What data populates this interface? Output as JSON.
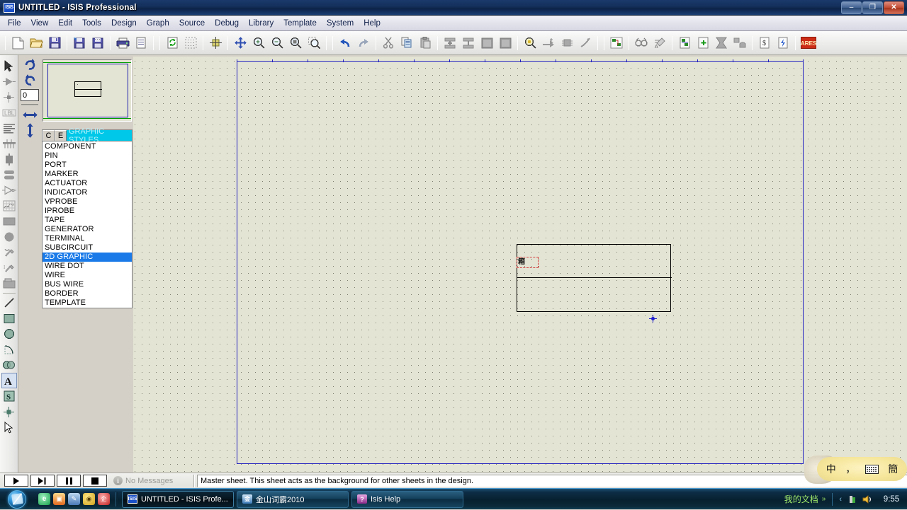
{
  "window": {
    "title": "UNTITLED - ISIS Professional",
    "app_icon": "isis-icon",
    "icon_label": "ISIS",
    "controls": {
      "minimize": "–",
      "restore": "❐",
      "close": "✕"
    }
  },
  "menubar": {
    "items": [
      {
        "label": "File",
        "name": "menu-file"
      },
      {
        "label": "View",
        "name": "menu-view"
      },
      {
        "label": "Edit",
        "name": "menu-edit"
      },
      {
        "label": "Tools",
        "name": "menu-tools"
      },
      {
        "label": "Design",
        "name": "menu-design"
      },
      {
        "label": "Graph",
        "name": "menu-graph"
      },
      {
        "label": "Source",
        "name": "menu-source"
      },
      {
        "label": "Debug",
        "name": "menu-debug"
      },
      {
        "label": "Library",
        "name": "menu-library"
      },
      {
        "label": "Template",
        "name": "menu-template"
      },
      {
        "label": "System",
        "name": "menu-system"
      },
      {
        "label": "Help",
        "name": "menu-help"
      }
    ]
  },
  "toolbar": {
    "groups": [
      [
        "new-file-icon",
        "open-folder-icon",
        "save-icon"
      ],
      [
        "save-as-icon",
        "import-section-icon"
      ],
      [
        "print-icon",
        "print-area-icon"
      ],
      [
        "refresh-icon",
        "toggle-grid-icon"
      ],
      [
        "origin-icon"
      ],
      [
        "pan-icon",
        "zoom-in-icon",
        "zoom-out-icon",
        "zoom-area-icon",
        "zoom-window-icon"
      ],
      [
        "undo-icon",
        "redo-icon"
      ],
      [
        "cut-icon",
        "copy-icon",
        "paste-icon"
      ],
      [
        "block-copy-icon",
        "block-move-icon",
        "block-rotate-icon",
        "block-delete-icon"
      ],
      [
        "pick-device-icon",
        "make-device-icon",
        "package-tool-icon",
        "decompose-icon"
      ],
      [
        "wire-label-icon"
      ],
      [
        "property-assign-icon"
      ],
      [
        "netlist-icon",
        "electrical-check-icon"
      ],
      [
        "new-sheet-icon",
        "remove-sheet-icon",
        "exit-sheet-icon",
        "sheet-hierarchy-icon"
      ],
      [
        "bom-report-icon",
        "electrical-report-icon"
      ],
      [
        "ares-button"
      ]
    ],
    "ares_label": "ARES"
  },
  "vtoolbar": {
    "items": [
      {
        "name": "selection-mode-icon",
        "label": "Selection Mode",
        "selected": false
      },
      {
        "name": "component-mode-icon",
        "label": "Component Mode",
        "selected": false
      },
      {
        "name": "junction-dot-icon",
        "label": "Junction Dot Mode",
        "selected": false
      },
      {
        "name": "wire-label-icon",
        "label": "Wire Label Mode",
        "selected": false
      },
      {
        "name": "text-script-icon",
        "label": "Text Script Mode",
        "selected": false
      },
      {
        "name": "buses-icon",
        "label": "Buses Mode",
        "selected": false
      },
      {
        "name": "subcircuit-icon",
        "label": "Subcircuit Mode",
        "selected": false
      },
      {
        "name": "terminals-icon",
        "label": "Terminals Mode",
        "selected": false
      },
      {
        "name": "device-pin-icon",
        "label": "Device Pins Mode",
        "selected": false
      },
      {
        "name": "graph-icon",
        "label": "Graph Mode",
        "selected": false
      },
      {
        "name": "tape-recorder-icon",
        "label": "Tape Recorder",
        "selected": false
      },
      {
        "name": "generator-icon",
        "label": "Generator Mode",
        "selected": false
      },
      {
        "name": "voltage-probe-icon",
        "label": "Voltage Probe",
        "selected": false
      },
      {
        "name": "current-probe-icon",
        "label": "Current Probe",
        "selected": false
      },
      {
        "name": "virtual-instrument-icon",
        "label": "Virtual Instruments",
        "selected": false
      },
      {
        "name": "line-tool-icon",
        "label": "2D Line",
        "selected": false
      },
      {
        "name": "box-tool-icon",
        "label": "2D Box",
        "selected": false
      },
      {
        "name": "circle-tool-icon",
        "label": "2D Circle",
        "selected": false
      },
      {
        "name": "arc-tool-icon",
        "label": "2D Arc",
        "selected": false
      },
      {
        "name": "path-tool-icon",
        "label": "2D Closed Path",
        "selected": false
      },
      {
        "name": "text-tool-icon",
        "label": "2D Text",
        "selected": true
      },
      {
        "name": "symbol-tool-icon",
        "label": "2D Symbol",
        "selected": false
      },
      {
        "name": "marker-tool-icon",
        "label": "2D Marker",
        "selected": false
      },
      {
        "name": "cursor-pointer-icon",
        "label": "Pointer",
        "selected": false
      }
    ]
  },
  "orientation": {
    "rotate_cw": "rotate-clockwise-icon",
    "rotate_ccw": "rotate-counterclockwise-icon",
    "angle_value": "0",
    "mirror_x": "mirror-horizontal-icon",
    "mirror_y": "mirror-vertical-icon"
  },
  "preview": {
    "name": "object-preview-panel"
  },
  "selector": {
    "tabs": [
      {
        "label": "C",
        "name": "tab-components"
      },
      {
        "label": "E",
        "name": "tab-edit"
      }
    ],
    "title": "GRAPHIC STYLES",
    "items": [
      "COMPONENT",
      "PIN",
      "PORT",
      "MARKER",
      "ACTUATOR",
      "INDICATOR",
      "VPROBE",
      "IPROBE",
      "TAPE",
      "GENERATOR",
      "TERMINAL",
      "SUBCIRCUIT",
      "2D GRAPHIC",
      "WIRE DOT",
      "WIRE",
      "BUS WIRE",
      "BORDER",
      "TEMPLATE"
    ],
    "selected_index": 12
  },
  "canvas": {
    "name": "schematic-canvas",
    "selected_object_glyph": "箱",
    "sheet_border_color": "#2020c0",
    "grid_color": "#6a6a5e",
    "background_color": "#e4e4d4"
  },
  "statusbar": {
    "animation_controls": [
      {
        "name": "play-button",
        "glyph": "▶"
      },
      {
        "name": "step-button",
        "glyph": "▶|"
      },
      {
        "name": "pause-button",
        "glyph": "❙❙"
      },
      {
        "name": "stop-button",
        "glyph": "■"
      }
    ],
    "messages_icon": "info-icon",
    "messages_label": "No Messages",
    "status_text": "Master sheet. This sheet acts as the background for other sheets in the design."
  },
  "taskbar": {
    "start_button": "start-orb",
    "quick_launch": [
      {
        "name": "ql-browser-icon",
        "glyph": "e"
      },
      {
        "name": "ql-media-icon",
        "glyph": "▣"
      },
      {
        "name": "ql-tool-icon",
        "glyph": "✎"
      },
      {
        "name": "ql-shield-icon",
        "glyph": "◉"
      },
      {
        "name": "ql-qq-icon",
        "glyph": "企"
      }
    ],
    "buttons": [
      {
        "name": "taskbtn-isis",
        "icon": "isis-icon",
        "icon_label": "ISIS",
        "label": "UNTITLED - ISIS Profe...",
        "active": true
      },
      {
        "name": "taskbtn-kingsoft",
        "icon": "kingsoft-icon",
        "icon_label": "金",
        "label": "金山词霸2010",
        "active": false
      },
      {
        "name": "taskbtn-isishelp",
        "icon": "help-book-icon",
        "icon_label": "?",
        "label": "Isis Help",
        "active": false
      }
    ],
    "tray": {
      "language_label": "我的文档",
      "expand_glyph": "»",
      "collapse_glyph": "‹",
      "icons": [
        {
          "name": "tray-network-icon",
          "glyph": "▮"
        },
        {
          "name": "tray-volume-icon",
          "glyph": "◕"
        }
      ],
      "clock": "9:55"
    }
  },
  "ime": {
    "name": "chinese-ime-toolbar",
    "buttons": [
      {
        "name": "ime-mode-chinese-button",
        "label": "中"
      },
      {
        "name": "ime-punctuation-button",
        "label": "，"
      },
      {
        "name": "ime-keyboard-button",
        "label": "keyboard-icon"
      },
      {
        "name": "ime-simplified-button",
        "label": "簡"
      }
    ]
  }
}
